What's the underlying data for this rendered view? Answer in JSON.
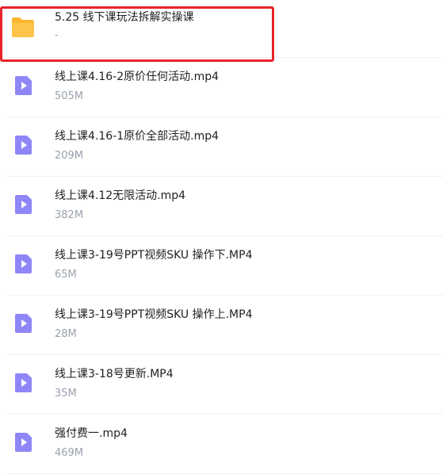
{
  "files": [
    {
      "name": "5.25 线下课玩法拆解实操课",
      "size": "-",
      "icon": "folder-icon",
      "type": "folder"
    },
    {
      "name": "线上课4.16-2原价任何活动.mp4",
      "size": "505M",
      "icon": "video-file-icon",
      "type": "video"
    },
    {
      "name": "线上课4.16-1原价全部活动.mp4",
      "size": "209M",
      "icon": "video-file-icon",
      "type": "video"
    },
    {
      "name": "线上课4.12无限活动.mp4",
      "size": "382M",
      "icon": "video-file-icon",
      "type": "video"
    },
    {
      "name": "线上课3-19号PPT视频SKU 操作下.MP4",
      "size": "65M",
      "icon": "video-file-icon",
      "type": "video"
    },
    {
      "name": "线上课3-19号PPT视频SKU 操作上.MP4",
      "size": "28M",
      "icon": "video-file-icon",
      "type": "video"
    },
    {
      "name": "线上课3-18号更新.MP4",
      "size": "35M",
      "icon": "video-file-icon",
      "type": "video"
    },
    {
      "name": "强付费一.mp4",
      "size": "469M",
      "icon": "video-file-icon",
      "type": "video"
    }
  ],
  "colors": {
    "folder": "#fbb631",
    "video": "#8f86f7",
    "highlight": "#e8232a"
  }
}
